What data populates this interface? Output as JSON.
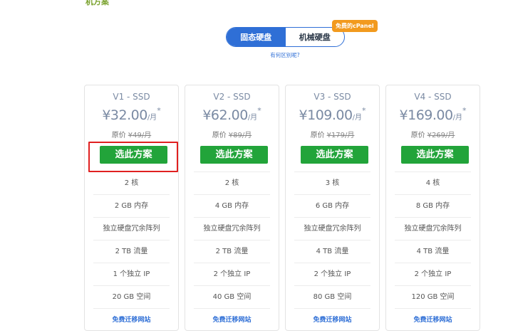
{
  "page_title": "机方案",
  "toggle": {
    "options": [
      {
        "label": "固态硬盘",
        "active": true
      },
      {
        "label": "机械硬盘",
        "active": false
      }
    ],
    "badge": "免费的cPanel"
  },
  "diff_link": "有何区别呢?",
  "plans": [
    {
      "name": "V1 - SSD",
      "currency": "¥",
      "price": "32.00",
      "unit": "/月",
      "star": "*",
      "orig_label": "原价",
      "orig_price": "¥49/月",
      "button": "选此方案",
      "features": [
        "2 核",
        "2 GB 内存",
        "独立硬盘冗余阵列",
        "2 TB 流量",
        "1 个独立 IP",
        "20 GB 空间"
      ],
      "migrate": "免费迁移网站"
    },
    {
      "name": "V2 - SSD",
      "currency": "¥",
      "price": "62.00",
      "unit": "/月",
      "star": "*",
      "orig_label": "原价",
      "orig_price": "¥89/月",
      "button": "选此方案",
      "features": [
        "2 核",
        "4 GB 内存",
        "独立硬盘冗余阵列",
        "2 TB 流量",
        "2 个独立 IP",
        "40 GB 空间"
      ],
      "migrate": "免费迁移网站"
    },
    {
      "name": "V3 - SSD",
      "currency": "¥",
      "price": "109.00",
      "unit": "/月",
      "star": "*",
      "orig_label": "原价",
      "orig_price": "¥179/月",
      "button": "选此方案",
      "features": [
        "3 核",
        "6 GB 内存",
        "独立硬盘冗余阵列",
        "4 TB 流量",
        "2 个独立 IP",
        "80 GB 空间"
      ],
      "migrate": "免费迁移网站"
    },
    {
      "name": "V4 - SSD",
      "currency": "¥",
      "price": "169.00",
      "unit": "/月",
      "star": "*",
      "orig_label": "原价",
      "orig_price": "¥269/月",
      "button": "选此方案",
      "features": [
        "4 核",
        "8 GB 内存",
        "独立硬盘冗余阵列",
        "4 TB 流量",
        "2 个独立 IP",
        "120 GB 空间"
      ],
      "migrate": "免费迁移网站"
    }
  ],
  "colors": {
    "accent_blue": "#2f6fd6",
    "button_green": "#22a43a",
    "badge_orange": "#f29a1e",
    "highlight_red": "#e02020"
  }
}
